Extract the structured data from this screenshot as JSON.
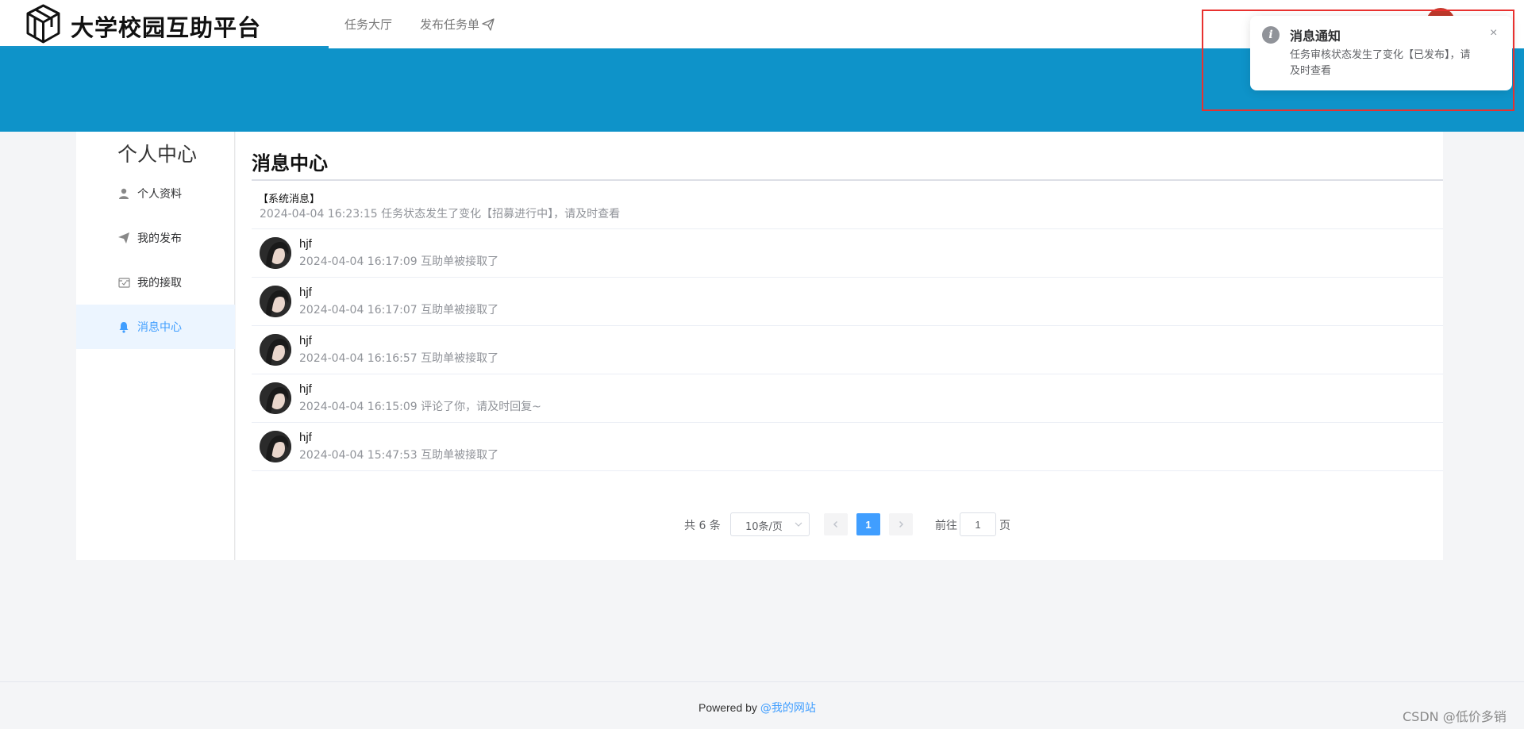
{
  "header": {
    "title": "大学校园互助平台",
    "nav": [
      {
        "label": "任务大厅"
      },
      {
        "label": "发布任务单"
      }
    ]
  },
  "sidebar": {
    "title": "个人中心",
    "items": [
      {
        "label": "个人资料",
        "icon": "user-icon"
      },
      {
        "label": "我的发布",
        "icon": "send-icon"
      },
      {
        "label": "我的接取",
        "icon": "inbox-check-icon"
      },
      {
        "label": "消息中心",
        "icon": "bell-icon",
        "active": true
      }
    ]
  },
  "main": {
    "title": "消息中心",
    "system_message": {
      "header": "【系统消息】",
      "text": "2024-04-04 16:23:15 任务状态发生了变化【招募进行中】，请及时查看"
    },
    "messages": [
      {
        "name": "hjf",
        "text": "2024-04-04 16:17:09 互助单被接取了"
      },
      {
        "name": "hjf",
        "text": "2024-04-04 16:17:07 互助单被接取了"
      },
      {
        "name": "hjf",
        "text": "2024-04-04 16:16:57 互助单被接取了"
      },
      {
        "name": "hjf",
        "text": "2024-04-04 16:15:09 评论了你，请及时回复~"
      },
      {
        "name": "hjf",
        "text": "2024-04-04 15:47:53 互助单被接取了"
      }
    ]
  },
  "pagination": {
    "total_label": "共 6 条",
    "page_size": "10条/页",
    "current_page": "1",
    "goto_label": "前往",
    "goto_value": "1",
    "page_label": "页"
  },
  "footer": {
    "prefix": "Powered by ",
    "link": "@我的网站"
  },
  "watermark": "CSDN @低价多销",
  "notification": {
    "title": "消息通知",
    "body": "任务审核状态发生了变化【已发布】，请及时查看",
    "close": "×"
  },
  "colors": {
    "banner": "#0e93c9",
    "accent": "#409eff",
    "highlight_border": "#e8312f"
  }
}
